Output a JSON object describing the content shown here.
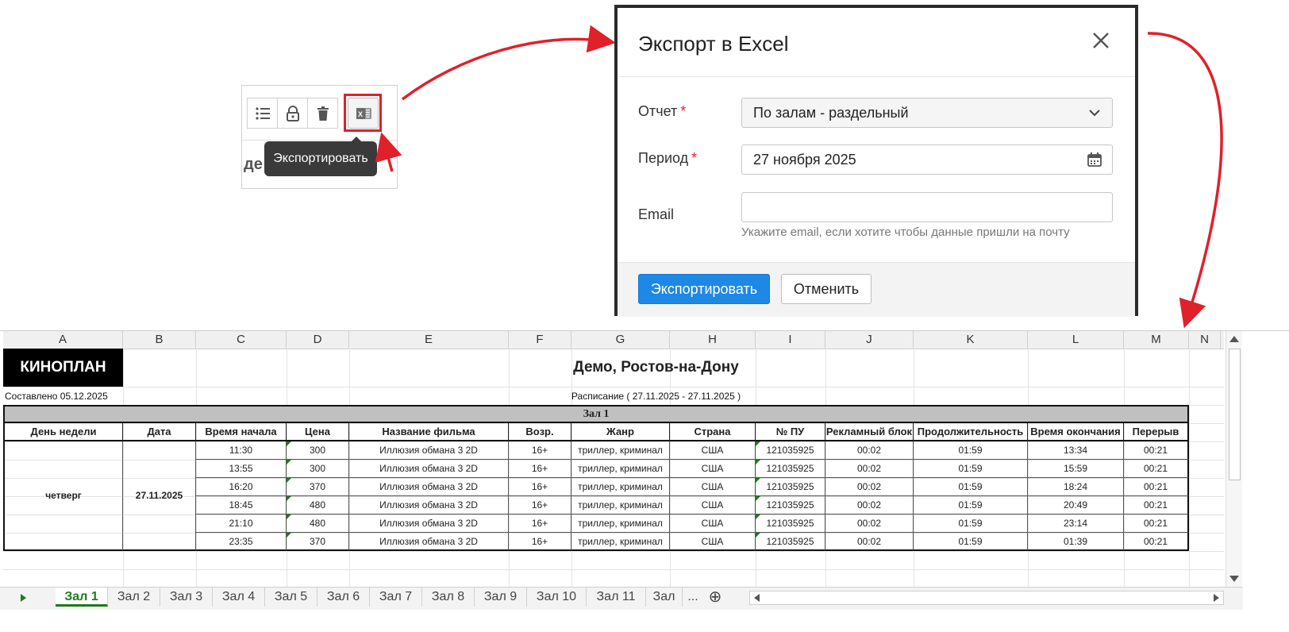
{
  "tooltip": {
    "label": "Экспортировать"
  },
  "toolbar": {
    "icons": [
      "list-icon",
      "lock-icon",
      "trash-icon",
      "excel-icon"
    ],
    "fragment": "де"
  },
  "modal": {
    "title": "Экспорт в Excel",
    "report_label": "Отчет",
    "report_value": "По залам - раздельный",
    "period_label": "Период",
    "period_value": "27 ноября 2025",
    "email_label": "Email",
    "email_value": "",
    "email_hint": "Укажите email, если хотите чтобы данные пришли на почту",
    "required_mark": "*",
    "export_button": "Экспортировать",
    "cancel_button": "Отменить"
  },
  "sheet": {
    "columns": [
      "A",
      "B",
      "C",
      "D",
      "E",
      "F",
      "G",
      "H",
      "I",
      "J",
      "K",
      "L",
      "M",
      "N"
    ],
    "logo": "КИНОПЛАН",
    "title": "Демо, Ростов-на-Дону",
    "compiled": "Составлено 05.12.2025",
    "schedule": "Расписание ( 27.11.2025 - 27.11.2025 )",
    "hall": "Зал 1",
    "headers": [
      "День недели",
      "Дата",
      "Время начала",
      "Цена",
      "Название фильма",
      "Возр.",
      "Жанр",
      "Страна",
      "№ ПУ",
      "Рекламный блок",
      "Продолжительность",
      "Время окончания",
      "Перерыв"
    ],
    "weekday": "четверг",
    "date": "27.11.2025",
    "rows": [
      [
        "11:30",
        "300",
        "Иллюзия обмана 3  2D",
        "16+",
        "триллер, криминал",
        "США",
        "121035925",
        "00:02",
        "01:59",
        "13:34",
        "00:21"
      ],
      [
        "13:55",
        "300",
        "Иллюзия обмана 3  2D",
        "16+",
        "триллер, криминал",
        "США",
        "121035925",
        "00:02",
        "01:59",
        "15:59",
        "00:21"
      ],
      [
        "16:20",
        "370",
        "Иллюзия обмана 3  2D",
        "16+",
        "триллер, криминал",
        "США",
        "121035925",
        "00:02",
        "01:59",
        "18:24",
        "00:21"
      ],
      [
        "18:45",
        "480",
        "Иллюзия обмана 3  2D",
        "16+",
        "триллер, криминал",
        "США",
        "121035925",
        "00:02",
        "01:59",
        "20:49",
        "00:21"
      ],
      [
        "21:10",
        "480",
        "Иллюзия обмана 3  2D",
        "16+",
        "триллер, криминал",
        "США",
        "121035925",
        "00:02",
        "01:59",
        "23:14",
        "00:21"
      ],
      [
        "23:35",
        "370",
        "Иллюзия обмана 3  2D",
        "16+",
        "триллер, криминал",
        "США",
        "121035925",
        "00:02",
        "01:59",
        "01:39",
        "00:21"
      ]
    ],
    "tabs": [
      "Зал 1",
      "Зал 2",
      "Зал 3",
      "Зал 4",
      "Зал 5",
      "Зал 6",
      "Зал 7",
      "Зал 8",
      "Зал 9",
      "Зал 10",
      "Зал 11",
      "Зал"
    ],
    "tabs_more": "...",
    "add_tab": "⊕",
    "colors": {
      "accent_green": "#1e7a1e",
      "primary_blue": "#1e88e5",
      "arrow_red": "#e0202a"
    }
  }
}
